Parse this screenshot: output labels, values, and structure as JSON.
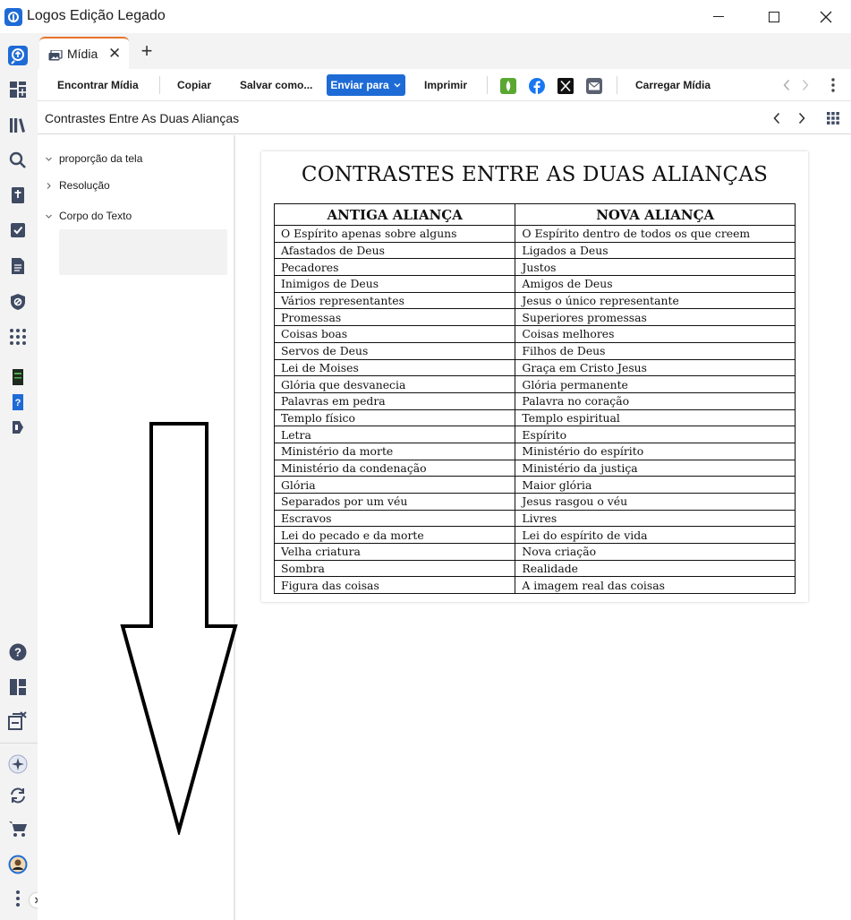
{
  "window": {
    "title": "Logos Edição Legado",
    "minimize_glyph": "—",
    "maximize_glyph": "☐",
    "close_glyph": "✕"
  },
  "tabs": [
    {
      "label": "Mídia",
      "close_glyph": "✕"
    }
  ],
  "tab_add_glyph": "+",
  "toolbar": {
    "find_media": "Encontrar Mídia",
    "copy": "Copiar",
    "save_as": "Salvar como...",
    "send_to": "Enviar para",
    "print": "Imprimir",
    "upload_media": "Carregar Mídia",
    "share_icons": [
      "faithlife-icon",
      "facebook-icon",
      "x-icon",
      "email-icon"
    ],
    "accent_color": "#1e6bd6"
  },
  "doc_header": {
    "title": "Contrastes Entre As Duas Alianças"
  },
  "left_panel": {
    "items": [
      {
        "label": "proporção da tela",
        "expanded": true
      },
      {
        "label": "Resolução",
        "expanded": false
      },
      {
        "label": "Corpo do Texto",
        "expanded": true
      }
    ]
  },
  "document": {
    "heading": "CONTRASTES ENTRE AS DUAS ALIANÇAS",
    "columns": [
      "ANTIGA ALIANÇA",
      "NOVA ALIANÇA"
    ],
    "rows": [
      [
        "O Espírito apenas sobre alguns",
        "O Espírito dentro de todos os que creem"
      ],
      [
        "Afastados de Deus",
        "Ligados a Deus"
      ],
      [
        "Pecadores",
        "Justos"
      ],
      [
        "Inimigos de Deus",
        "Amigos de Deus"
      ],
      [
        "Vários representantes",
        "Jesus o único representante"
      ],
      [
        "Promessas",
        "Superiores promessas"
      ],
      [
        "Coisas boas",
        "Coisas melhores"
      ],
      [
        "Servos de Deus",
        "Filhos de Deus"
      ],
      [
        "Lei de Moises",
        "Graça em Cristo Jesus"
      ],
      [
        "Glória que desvanecia",
        "Glória permanente"
      ],
      [
        "Palavras em pedra",
        "Palavra no coração"
      ],
      [
        "Templo físico",
        "Templo espiritual"
      ],
      [
        "Letra",
        "Espírito"
      ],
      [
        "Ministério da morte",
        "Ministério do espírito"
      ],
      [
        "Ministério da condenação",
        "Ministério da justiça"
      ],
      [
        "Glória",
        "Maior glória"
      ],
      [
        "Separados por um véu",
        "Jesus rasgou o véu"
      ],
      [
        "Escravos",
        "Livres"
      ],
      [
        "Lei do pecado e da morte",
        "Lei do espírito de vida"
      ],
      [
        "Velha criatura",
        "Nova criação"
      ],
      [
        "Sombra",
        "Realidade"
      ],
      [
        "Figura das coisas",
        "A imagem real das coisas"
      ]
    ]
  },
  "rail_icons": [
    "logos-search-icon",
    "dashboard-icon",
    "library-icon",
    "search-icon",
    "bible-icon",
    "checklist-icon",
    "document-icon",
    "shield-icon",
    "apps-grid-icon",
    "book-green-icon",
    "book-question-icon",
    "tag-icon",
    "help-icon",
    "layout-icon",
    "close-panels-icon",
    "ai-sparkle-icon",
    "sync-icon",
    "cart-icon",
    "user-avatar-icon",
    "more-vertical-icon"
  ]
}
